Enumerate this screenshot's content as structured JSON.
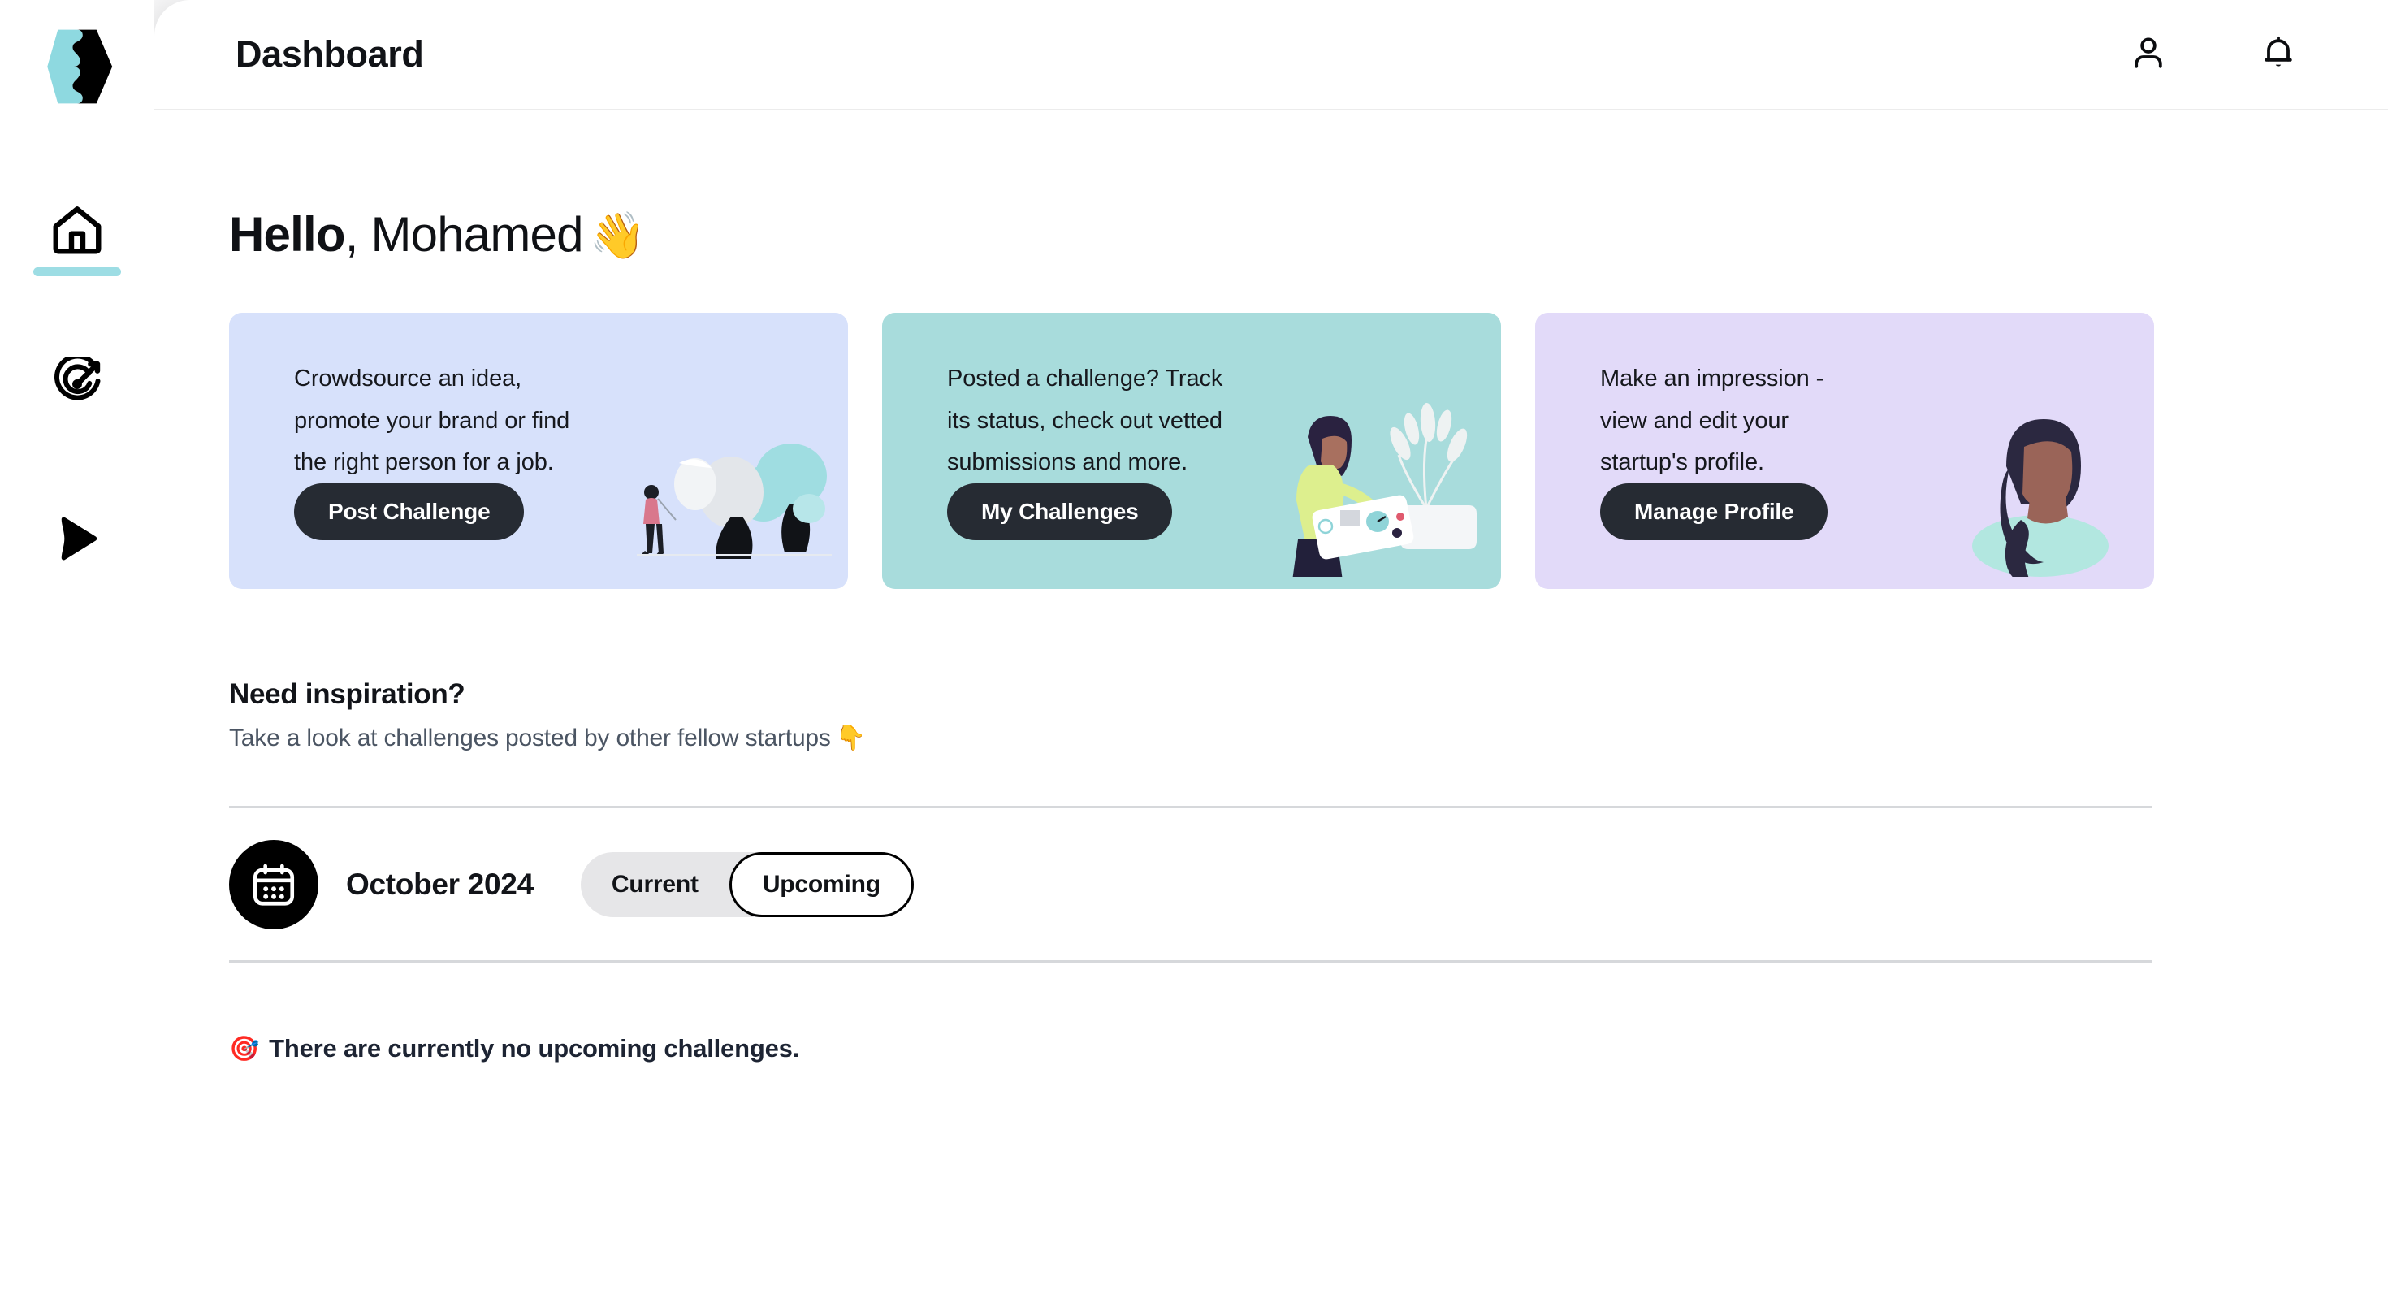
{
  "brand": {
    "logo_name": "hexagon-puzzle-logo",
    "logo_teal": "#8ed9e0",
    "logo_black": "#000000"
  },
  "sidebar": {
    "items": [
      {
        "icon": "home-icon",
        "name": "home",
        "active": true
      },
      {
        "icon": "target-icon",
        "name": "challenges",
        "active": false
      },
      {
        "icon": "send-icon",
        "name": "submissions",
        "active": false
      }
    ],
    "active_indicator_color": "#9ddde4"
  },
  "header": {
    "title": "Dashboard",
    "actions": [
      {
        "icon": "user-icon",
        "label": "Account"
      },
      {
        "icon": "bell-icon",
        "label": "Notifications"
      }
    ]
  },
  "greeting": {
    "bold": "Hello",
    "rest": ", Mohamed",
    "emoji": "👋"
  },
  "cards": [
    {
      "text": "Crowdsource an idea,\npromote your brand or find\nthe right person for a job.",
      "button": "Post Challenge",
      "bg": "#d7e1fb",
      "art": "person-trees-illustration"
    },
    {
      "text": "Posted a challenge? Track\nits status, check out vetted\nsubmissions and more.",
      "button": "My Challenges",
      "bg": "#a8dcdc",
      "art": "woman-whiteboard-illustration"
    },
    {
      "text": "Make an impression -\nview and edit your\nstartup's profile.",
      "button": "Manage Profile",
      "bg": "#e2daf9",
      "art": "woman-portrait-illustration"
    }
  ],
  "inspiration": {
    "title": "Need inspiration?",
    "subtitle": "Take a look at challenges posted by other fellow startups",
    "subtitle_emoji": "👇"
  },
  "calendar": {
    "icon": "calendar-icon",
    "month": "October 2024",
    "toggle": {
      "options": [
        "Current",
        "Upcoming"
      ],
      "selected": "Upcoming"
    }
  },
  "empty_state": {
    "emoji": "🎯",
    "message": "There are currently no upcoming challenges."
  },
  "colors": {
    "button_dark": "#262b33",
    "divider": "#d6d8db",
    "accent_teal": "#9ddde4",
    "text_dark": "#121419",
    "text_muted": "#4b5563"
  }
}
